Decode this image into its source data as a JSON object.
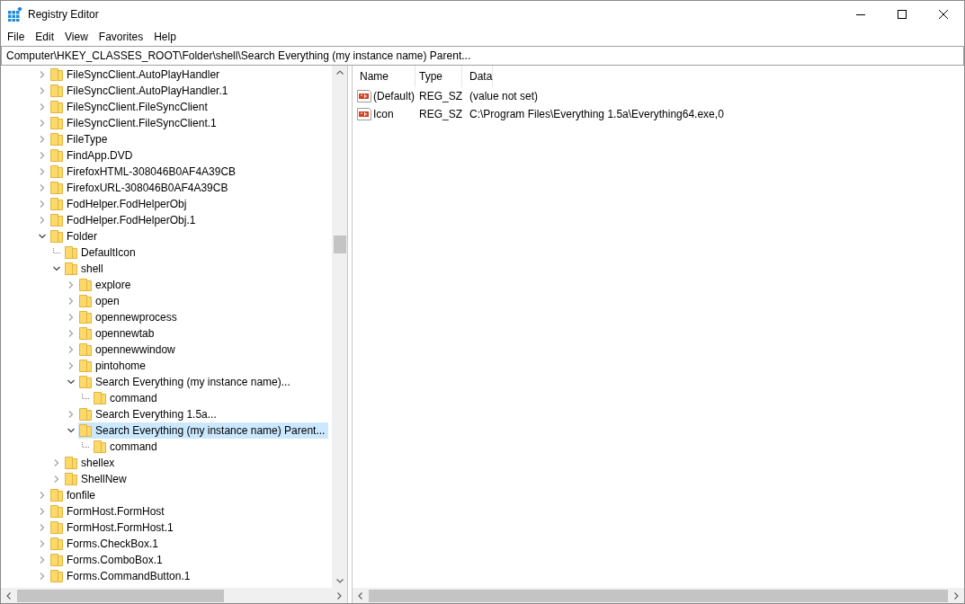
{
  "window": {
    "title": "Registry Editor"
  },
  "menu": [
    "File",
    "Edit",
    "View",
    "Favorites",
    "Help"
  ],
  "address": "Computer\\HKEY_CLASSES_ROOT\\Folder\\shell\\Search Everything (my instance name) Parent...",
  "tree": [
    {
      "label": "FileSyncClient.AutoPlayHandler",
      "kind": "branch",
      "expanded": false,
      "selected": false
    },
    {
      "label": "FileSyncClient.AutoPlayHandler.1",
      "kind": "branch",
      "expanded": false,
      "selected": false
    },
    {
      "label": "FileSyncClient.FileSyncClient",
      "kind": "branch",
      "expanded": false,
      "selected": false
    },
    {
      "label": "FileSyncClient.FileSyncClient.1",
      "kind": "branch",
      "expanded": false,
      "selected": false
    },
    {
      "label": "FileType",
      "kind": "branch",
      "expanded": false,
      "selected": false
    },
    {
      "label": "FindApp.DVD",
      "kind": "branch",
      "expanded": false,
      "selected": false
    },
    {
      "label": "FirefoxHTML-308046B0AF4A39CB",
      "kind": "branch",
      "expanded": false,
      "selected": false
    },
    {
      "label": "FirefoxURL-308046B0AF4A39CB",
      "kind": "branch",
      "expanded": false,
      "selected": false
    },
    {
      "label": "FodHelper.FodHelperObj",
      "kind": "branch",
      "expanded": false,
      "selected": false
    },
    {
      "label": "FodHelper.FodHelperObj.1",
      "kind": "branch",
      "expanded": false,
      "selected": false
    },
    {
      "label": "Folder",
      "kind": "branch",
      "expanded": true,
      "selected": false,
      "children": [
        {
          "label": "DefaultIcon",
          "kind": "leaf",
          "expanded": false,
          "selected": false
        },
        {
          "label": "shell",
          "kind": "branch",
          "expanded": true,
          "selected": false,
          "children": [
            {
              "label": "explore",
              "kind": "branch",
              "expanded": false,
              "selected": false
            },
            {
              "label": "open",
              "kind": "branch",
              "expanded": false,
              "selected": false
            },
            {
              "label": "opennewprocess",
              "kind": "branch",
              "expanded": false,
              "selected": false
            },
            {
              "label": "opennewtab",
              "kind": "branch",
              "expanded": false,
              "selected": false
            },
            {
              "label": "opennewwindow",
              "kind": "branch",
              "expanded": false,
              "selected": false
            },
            {
              "label": "pintohome",
              "kind": "branch",
              "expanded": false,
              "selected": false
            },
            {
              "label": "Search Everything (my instance name)...",
              "kind": "branch",
              "expanded": true,
              "selected": false,
              "children": [
                {
                  "label": "command",
                  "kind": "leaf",
                  "expanded": false,
                  "selected": false
                }
              ]
            },
            {
              "label": "Search Everything 1.5a...",
              "kind": "branch",
              "expanded": false,
              "selected": false
            },
            {
              "label": "Search Everything (my instance name) Parent...",
              "kind": "branch",
              "expanded": true,
              "selected": true,
              "children": [
                {
                  "label": "command",
                  "kind": "leaf",
                  "expanded": false,
                  "selected": false
                }
              ]
            }
          ]
        },
        {
          "label": "shellex",
          "kind": "branch",
          "expanded": false,
          "selected": false
        },
        {
          "label": "ShellNew",
          "kind": "branch",
          "expanded": false,
          "selected": false
        }
      ]
    },
    {
      "label": "fonfile",
      "kind": "branch",
      "expanded": false,
      "selected": false
    },
    {
      "label": "FormHost.FormHost",
      "kind": "branch",
      "expanded": false,
      "selected": false
    },
    {
      "label": "FormHost.FormHost.1",
      "kind": "branch",
      "expanded": false,
      "selected": false
    },
    {
      "label": "Forms.CheckBox.1",
      "kind": "branch",
      "expanded": false,
      "selected": false
    },
    {
      "label": "Forms.ComboBox.1",
      "kind": "branch",
      "expanded": false,
      "selected": false
    },
    {
      "label": "Forms.CommandButton.1",
      "kind": "branch",
      "expanded": false,
      "selected": false
    }
  ],
  "values": {
    "columns": [
      "Name",
      "Type",
      "Data"
    ],
    "rows": [
      {
        "name": "(Default)",
        "type": "REG_SZ",
        "data": "(value not set)"
      },
      {
        "name": "Icon",
        "type": "REG_SZ",
        "data": "C:\\Program Files\\Everything 1.5a\\Everything64.exe,0"
      }
    ]
  }
}
